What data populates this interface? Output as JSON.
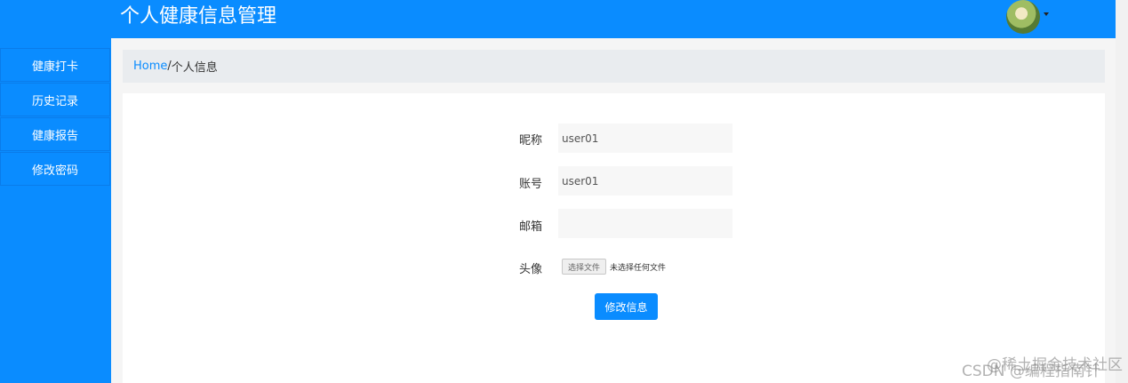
{
  "header": {
    "title": "个人健康信息管理",
    "avatar_icon": "user-avatar"
  },
  "sidebar": {
    "items": [
      {
        "label": "健康打卡"
      },
      {
        "label": "历史记录"
      },
      {
        "label": "健康报告"
      },
      {
        "label": "修改密码"
      }
    ]
  },
  "breadcrumb": {
    "home": "Home",
    "separator": "/",
    "current": "个人信息"
  },
  "form": {
    "nickname": {
      "label": "昵称",
      "value": "user01"
    },
    "account": {
      "label": "账号",
      "value": "user01"
    },
    "email": {
      "label": "邮箱",
      "value": ""
    },
    "avatar": {
      "label": "头像",
      "button": "选择文件",
      "status": "未选择任何文件"
    },
    "submit": "修改信息"
  },
  "watermark": {
    "line1": "@稀土掘金技术社区",
    "line2": "CSDN @编程指南针"
  }
}
